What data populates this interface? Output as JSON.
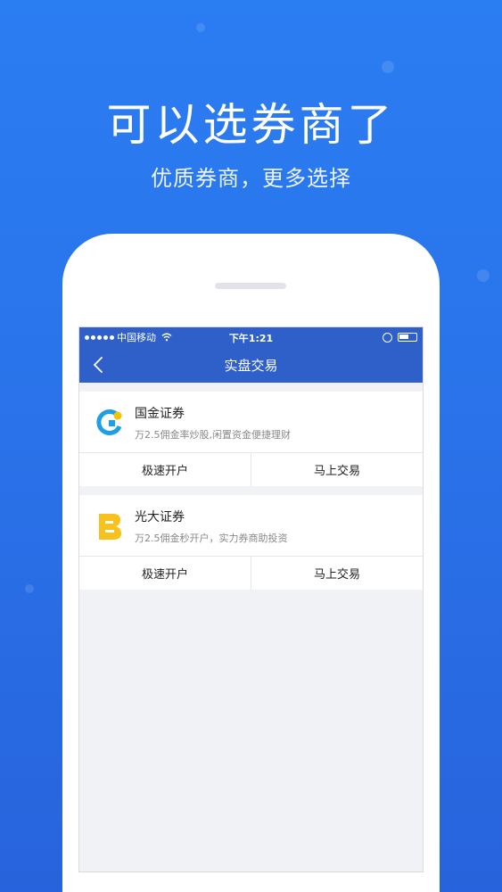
{
  "hero": {
    "title": "可以选券商了",
    "subtitle": "优质券商，更多选择"
  },
  "status_bar": {
    "carrier": "中国移动",
    "time": "下午1:21"
  },
  "nav": {
    "title": "实盘交易"
  },
  "brokers": [
    {
      "name": "国金证券",
      "desc": "万2.5佣金率炒股,闲置资金便捷理财",
      "open_label": "极速开户",
      "trade_label": "马上交易",
      "logo_icon": "guojin-logo-icon"
    },
    {
      "name": "光大证券",
      "desc": "万2.5佣金秒开户，实力券商助投资",
      "open_label": "极速开户",
      "trade_label": "马上交易",
      "logo_icon": "everbright-logo-icon"
    }
  ],
  "colors": {
    "background_top": "#2b7df2",
    "background_bottom": "#2763dc",
    "nav_blue": "#2f5fc8",
    "guojin_blue": "#1f9ee8",
    "guojin_yellow": "#f5c400",
    "everbright_yellow": "#f7c21b"
  }
}
